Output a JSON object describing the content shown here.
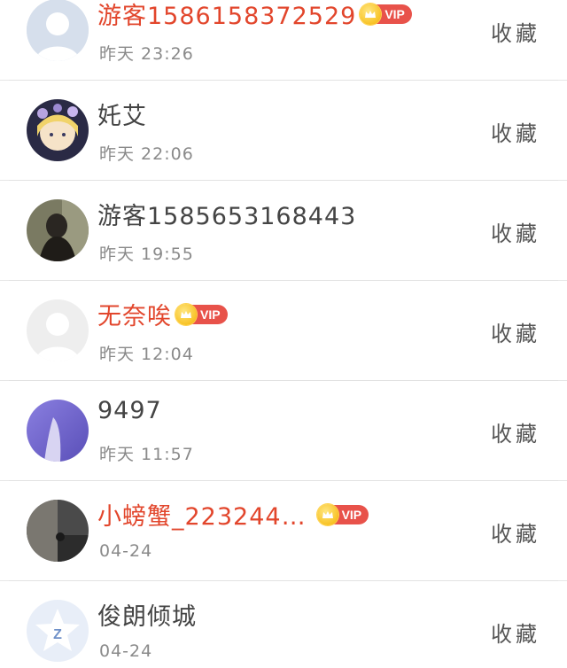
{
  "favorite_label": "收藏",
  "vip_label": "VIP",
  "items": [
    {
      "name": "游客15861583725​29",
      "time": "昨天 23:26",
      "vip": true
    },
    {
      "name": "奼艾",
      "time": "昨天 22:06",
      "vip": false
    },
    {
      "name": "游客15856531684​43",
      "time": "昨天 19:55",
      "vip": false
    },
    {
      "name": "无奈唉",
      "time": "昨天 12:04",
      "vip": true
    },
    {
      "name": "9497",
      "time": "昨天 11:57",
      "vip": false
    },
    {
      "name": "小螃蟹_223244…",
      "time": "04-24",
      "vip": true
    },
    {
      "name": "俊朗倾城",
      "time": "04-24",
      "vip": false
    }
  ],
  "colors": {
    "vip_name": "#e2462c",
    "normal_name": "#444444",
    "time": "#8a8a8a",
    "vip_badge": "#e8524a",
    "divider": "#e2e2e2"
  }
}
